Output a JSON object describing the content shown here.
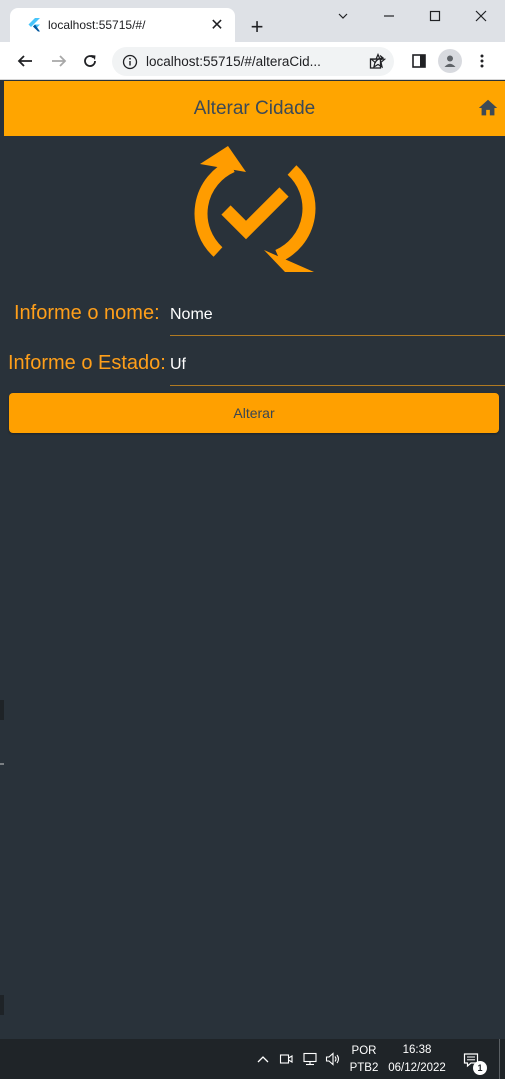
{
  "browser": {
    "tab_title": "localhost:55715/#/",
    "url": "localhost:55715/#/alteraCid..."
  },
  "appbar": {
    "title": "Alterar Cidade",
    "background_color": "#ffa500",
    "icon": "home-icon"
  },
  "logo": {
    "icon": "sync-check-icon",
    "color": "#ff9c00"
  },
  "form": {
    "nome_label": "Informe o nome:",
    "nome_placeholder": "Nome",
    "estado_label": "Informe o Estado:",
    "estado_placeholder": "Uf",
    "submit_label": "Alterar",
    "accent_color": "#ffa000"
  },
  "taskbar": {
    "language_line1": "POR",
    "language_line2": "PTB2",
    "time": "16:38",
    "date": "06/12/2022",
    "notification_count": "1"
  }
}
